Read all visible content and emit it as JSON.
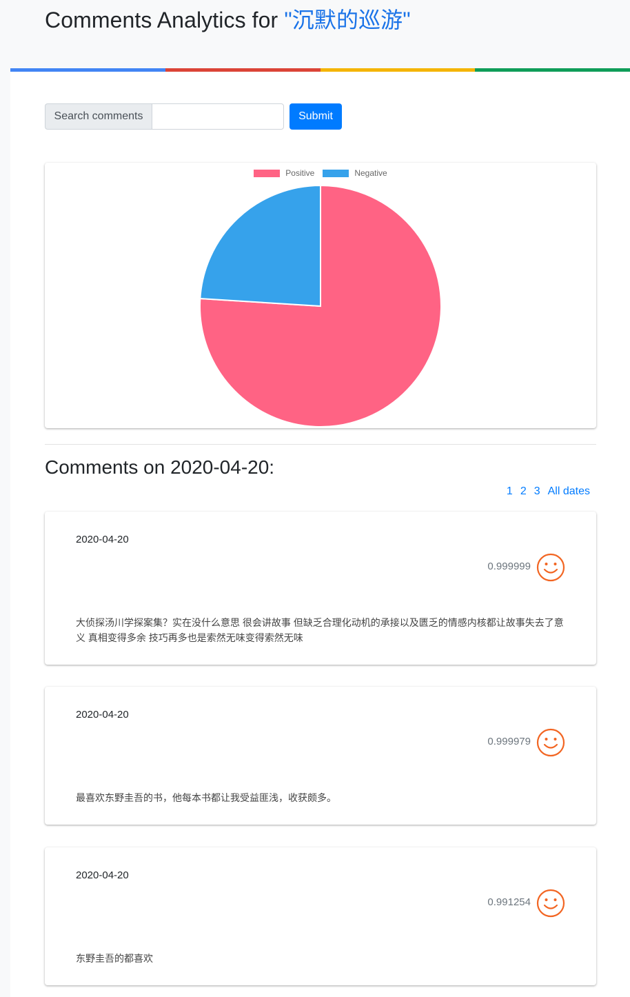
{
  "header": {
    "title_prefix": "Comments Analytics for ",
    "book_title": "\"沉默的巡游\"",
    "bar_colors": [
      "#4285f4",
      "#db4437",
      "#f4b400",
      "#0f9d58"
    ]
  },
  "search": {
    "label": "Search comments",
    "value": "",
    "placeholder": "",
    "submit_label": "Submit"
  },
  "chart_data": {
    "type": "pie",
    "labels": [
      "Positive",
      "Negative"
    ],
    "values": [
      76,
      24
    ],
    "colors": [
      "#ff6384",
      "#36a2eb"
    ],
    "legend": "top-center"
  },
  "section": {
    "title": "Comments on 2020-04-20:"
  },
  "pagination": {
    "pages": [
      "1",
      "2",
      "3"
    ],
    "all_label": "All dates"
  },
  "comments": [
    {
      "date": "2020-04-20",
      "score": "0.999999",
      "icon": "smile-icon",
      "text": "大侦探汤川学探案集？实在没什么意思 很会讲故事 但缺乏合理化动机的承接以及匮乏的情感内核都让故事失去了意义 真相变得多余 技巧再多也是索然无味变得索然无味"
    },
    {
      "date": "2020-04-20",
      "score": "0.999979",
      "icon": "smile-icon",
      "text": "最喜欢东野圭吾的书，他每本书都让我受益匪浅，收获颇多。"
    },
    {
      "date": "2020-04-20",
      "score": "0.991254",
      "icon": "smile-icon",
      "text": "东野圭吾的都喜欢"
    }
  ],
  "colors": {
    "accent": "#007bff",
    "smile": "#f26522",
    "book_title": "#1a73e8"
  }
}
